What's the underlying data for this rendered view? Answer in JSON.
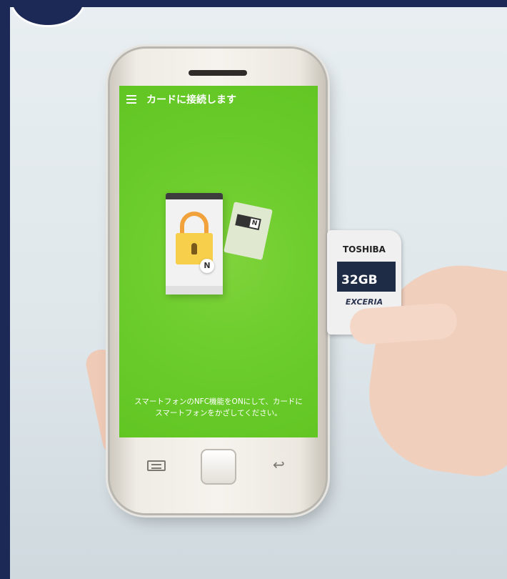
{
  "app_screen": {
    "title": "カードに接続します",
    "instruction_line1": "スマートフォンのNFC機能をONにして、カードに",
    "instruction_line2": "スマートフォンをかざしてください。",
    "illustration_nfc_mark": "N",
    "accent_green": "#6ccd2c"
  },
  "sd_card": {
    "brand": "TOSHIBA",
    "capacity": "32GB",
    "series": "EXCERIA"
  },
  "icons": [
    "menu-icon",
    "lock-icon",
    "nfc-icon",
    "nav-menu-icon",
    "home-button",
    "back-icon"
  ]
}
